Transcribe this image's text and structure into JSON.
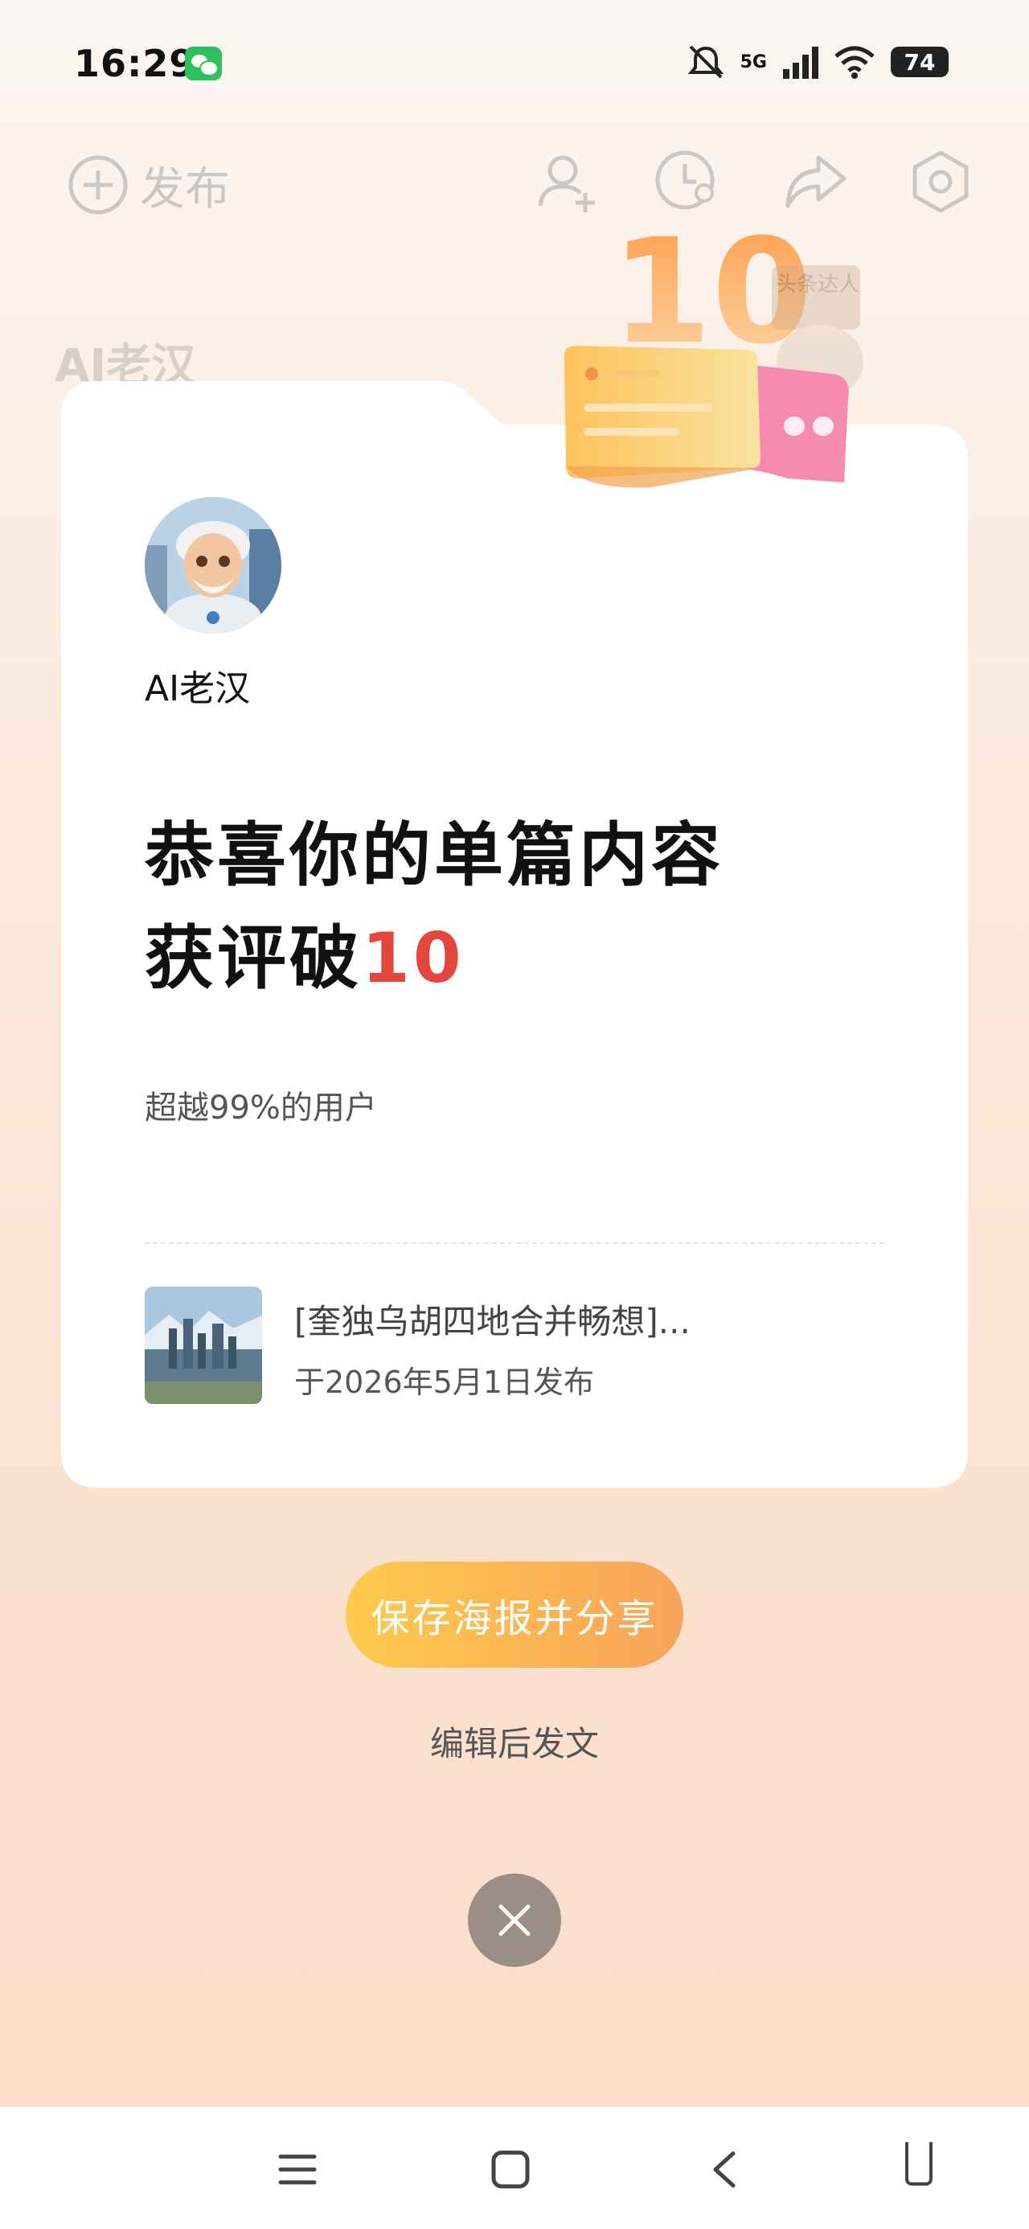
{
  "status_bar": {
    "time": "16:29",
    "network": "5G",
    "battery": "74"
  },
  "background_header": {
    "publish_label": "发布",
    "author_name": "AI老汉"
  },
  "decoration": {
    "number": "10",
    "sign_text": "头条达人"
  },
  "card": {
    "username": "AI老汉",
    "headline_line1": "恭喜你的单篇内容",
    "headline_line2_prefix": "获评破",
    "headline_number": "10",
    "subtext": "超越99%的用户",
    "post": {
      "title": "[奎独乌胡四地合并畅想]...",
      "date": "于2026年5月1日发布"
    }
  },
  "actions": {
    "save_share_label": "保存海报并分享",
    "edit_label": "编辑后发文"
  },
  "colors": {
    "accent_red": "#e5453f",
    "button_start": "#ffca4c",
    "button_end": "#f8a35a"
  }
}
